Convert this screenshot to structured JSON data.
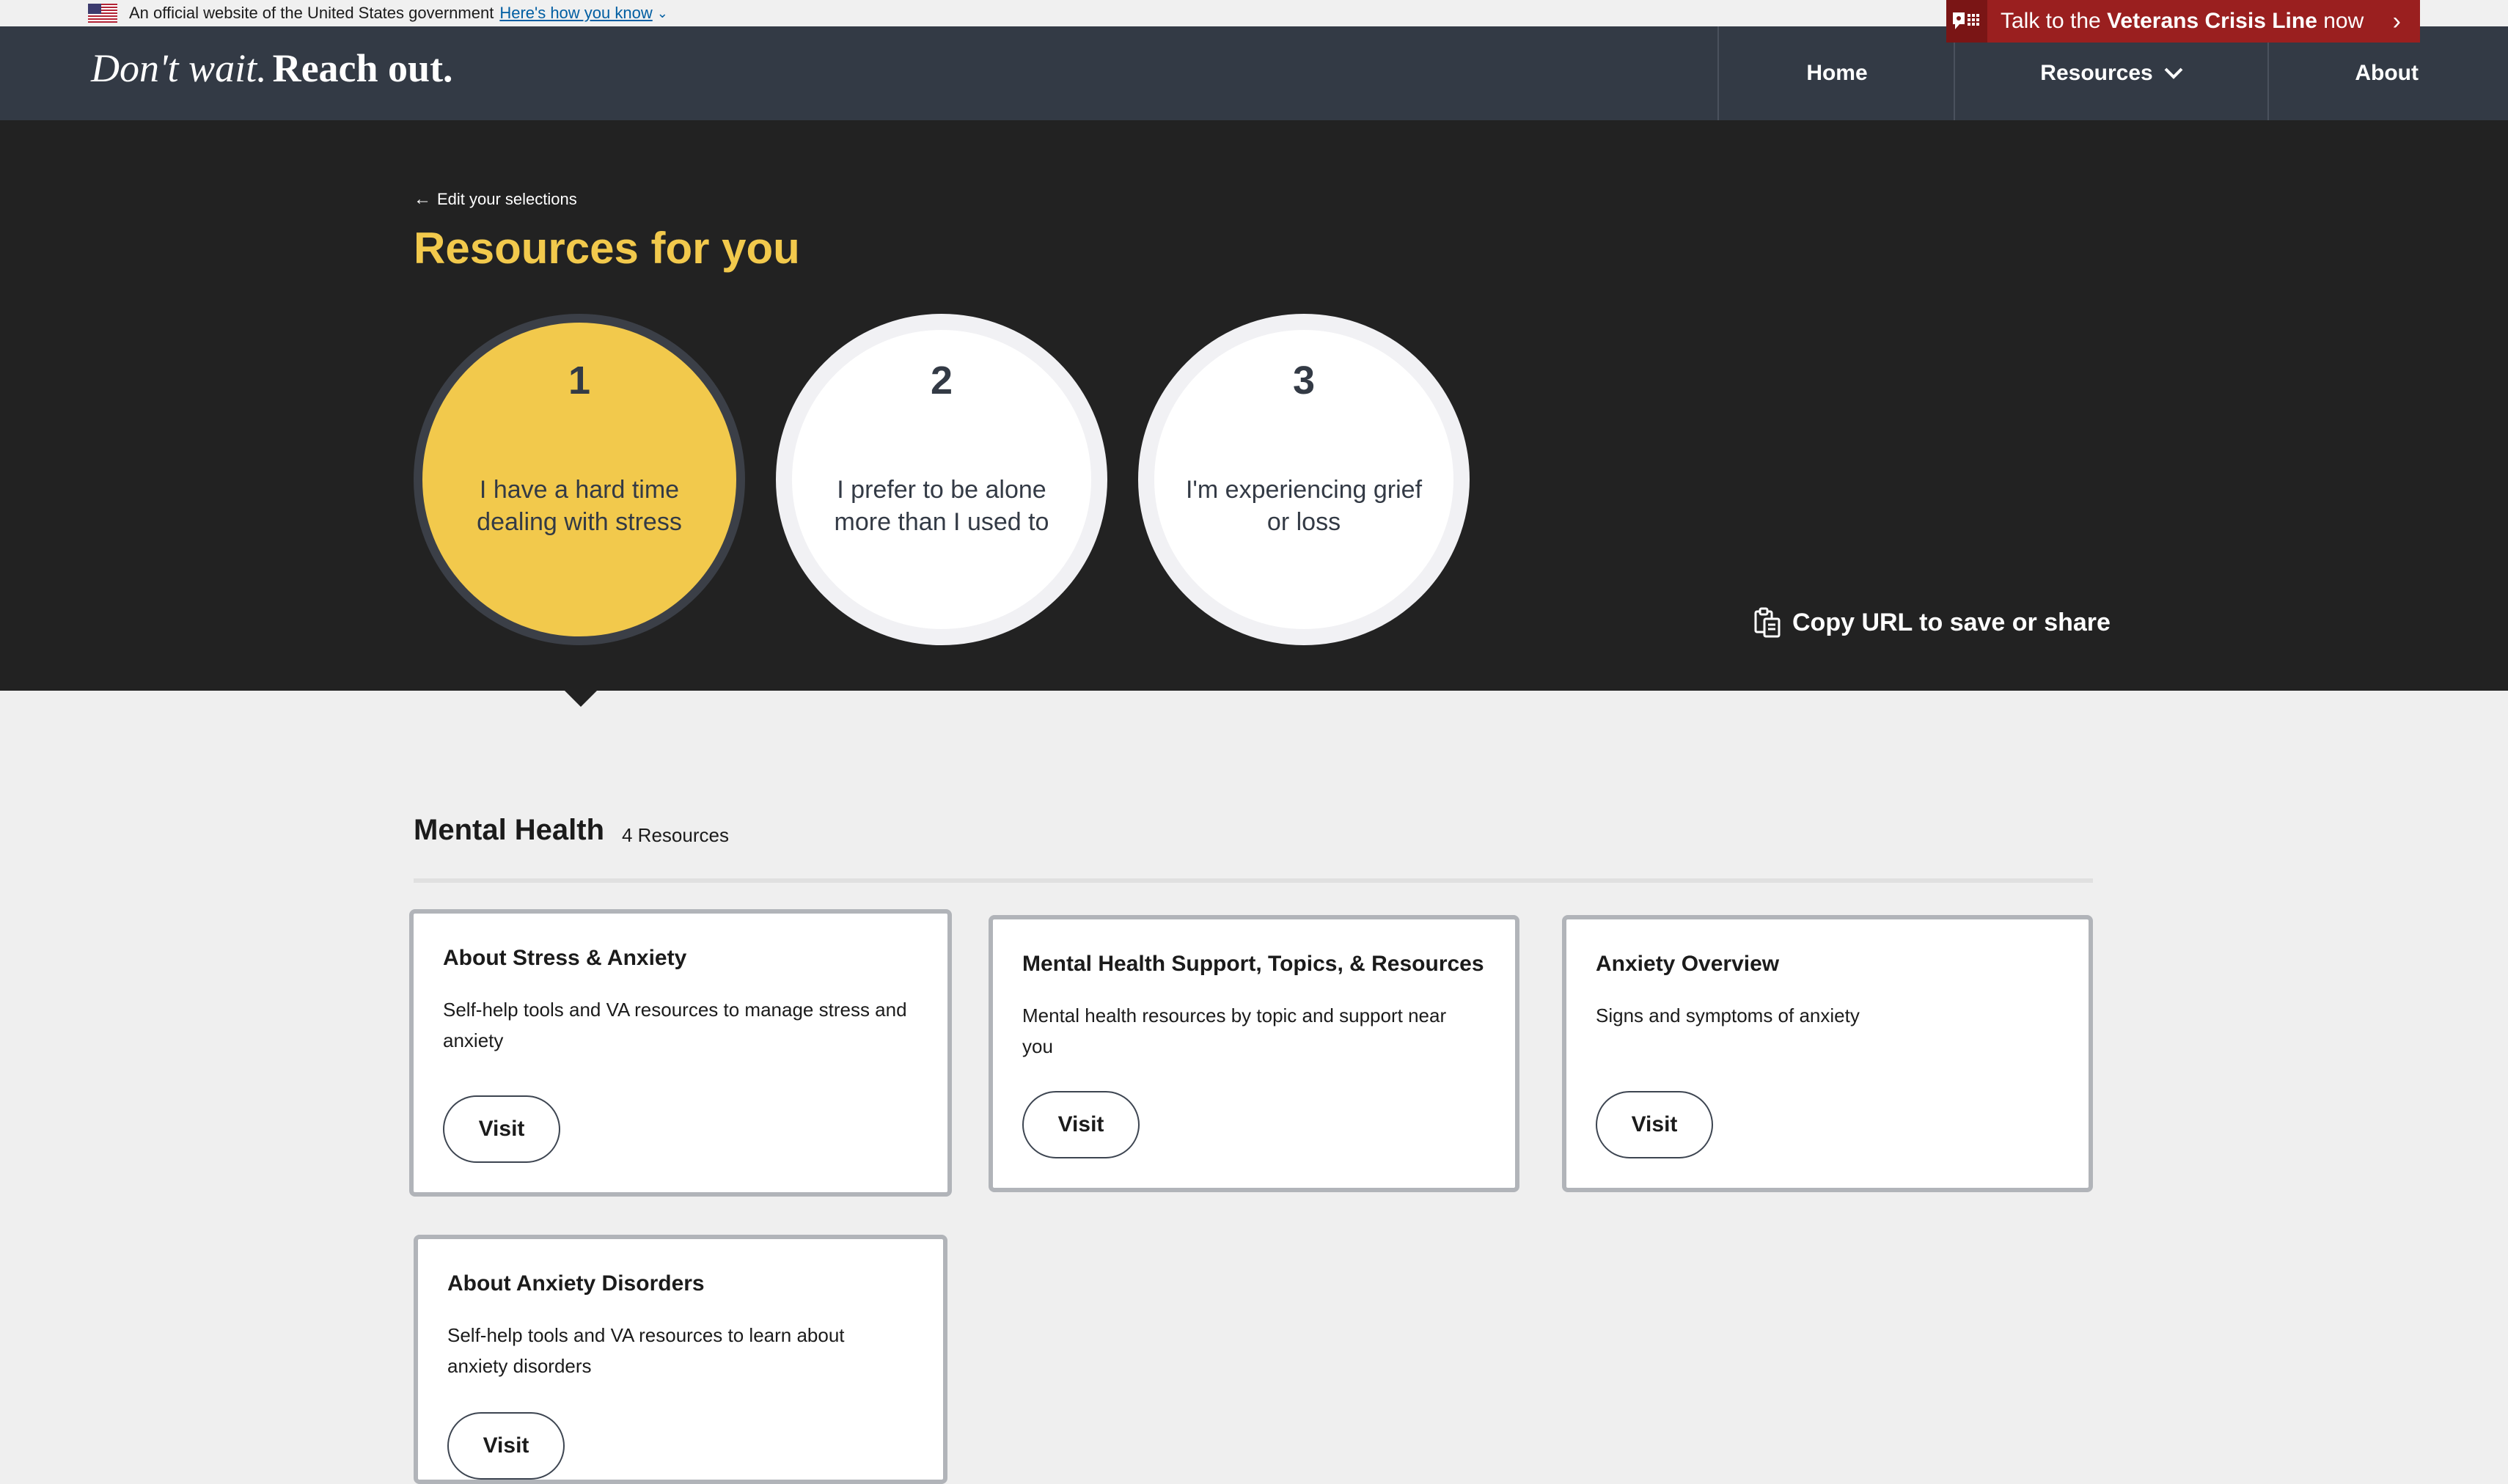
{
  "gov_banner": {
    "text": "An official website of the United States government",
    "link": "Here's how you know"
  },
  "header": {
    "logo_italic": "Don't wait.",
    "logo_bold": "Reach out.",
    "nav": {
      "home": "Home",
      "resources": "Resources",
      "about": "About"
    }
  },
  "crisis_line": {
    "prefix": "Talk to the ",
    "name": "Veterans Crisis Line",
    "suffix": " now",
    "color": "#9a1f1f"
  },
  "hero": {
    "back_link": "Edit your selections",
    "title": "Resources for you",
    "selections": [
      {
        "number": "1",
        "label": "I have a hard time dealing with stress",
        "active": true
      },
      {
        "number": "2",
        "label": "I prefer to be alone more than I used to",
        "active": false
      },
      {
        "number": "3",
        "label": "I'm experiencing grief or loss",
        "active": false
      }
    ],
    "copy_url": "Copy URL to save or share",
    "accent_color": "#f2c94c"
  },
  "section": {
    "title": "Mental Health",
    "count": "4 Resources",
    "cards": [
      {
        "title": "About Stress & Anxiety",
        "description": "Self-help tools and VA resources to manage stress and anxiety",
        "button": "Visit"
      },
      {
        "title": "Mental Health Support, Topics, & Resources",
        "description": "Mental health resources by topic and support near you",
        "button": "Visit"
      },
      {
        "title": "Anxiety Overview",
        "description": "Signs and symptoms of anxiety",
        "button": "Visit"
      },
      {
        "title": "About Anxiety Disorders",
        "description": "Self-help tools and VA resources to learn about anxiety disorders",
        "button": "Visit"
      }
    ]
  }
}
